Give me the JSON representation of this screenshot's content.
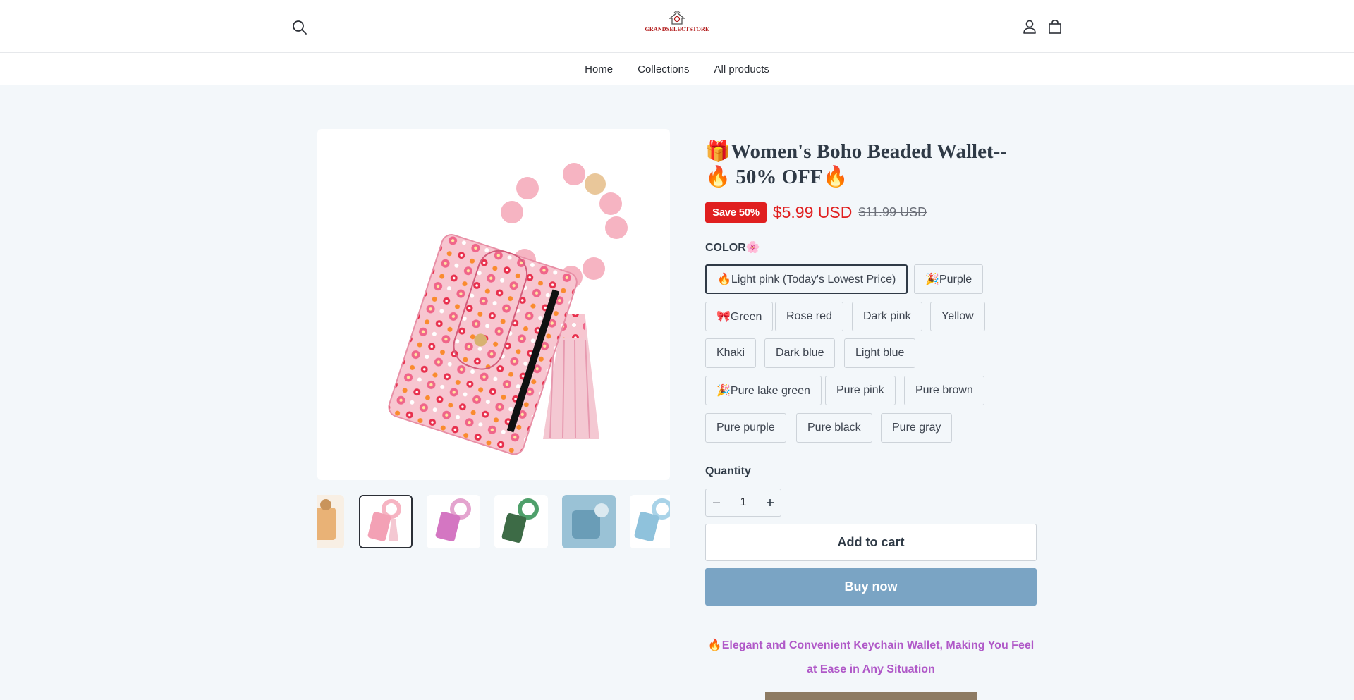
{
  "store": {
    "name": "GRANDSELECTSTORE"
  },
  "nav": {
    "items": [
      "Home",
      "Collections",
      "All products"
    ]
  },
  "product": {
    "title": "🎁Women's Boho Beaded Wallet--🔥 50% OFF🔥",
    "save_badge": "Save 50%",
    "price": "$5.99 USD",
    "compare_price": "$11.99 USD",
    "option_label": "COLOR🌸",
    "options": [
      "🔥Light pink (Today's Lowest Price)",
      "🎉Purple",
      "🎀Green",
      "Rose red",
      "Dark pink",
      "Yellow",
      "Khaki",
      "Dark blue",
      "Light blue",
      "🎉Pure lake green",
      "Pure pink",
      "Pure brown",
      "Pure purple",
      "Pure black",
      "Pure gray"
    ],
    "selected_option": "🔥Light pink (Today's Lowest Price)",
    "quantity_label": "Quantity",
    "quantity": "1",
    "add_to_cart": "Add to cart",
    "buy_now": "Buy now",
    "description_headline": "🔥Elegant and Convenient Keychain Wallet, Making You Feel at Ease in Any Situation"
  },
  "colors": {
    "sale": "#e01f1f",
    "buy_now_bg": "#7aa4c4",
    "description": "#b059c8",
    "page_bg": "#f3f7fa"
  },
  "icons": [
    "search-icon",
    "account-icon",
    "cart-icon",
    "minus-icon",
    "plus-icon"
  ]
}
